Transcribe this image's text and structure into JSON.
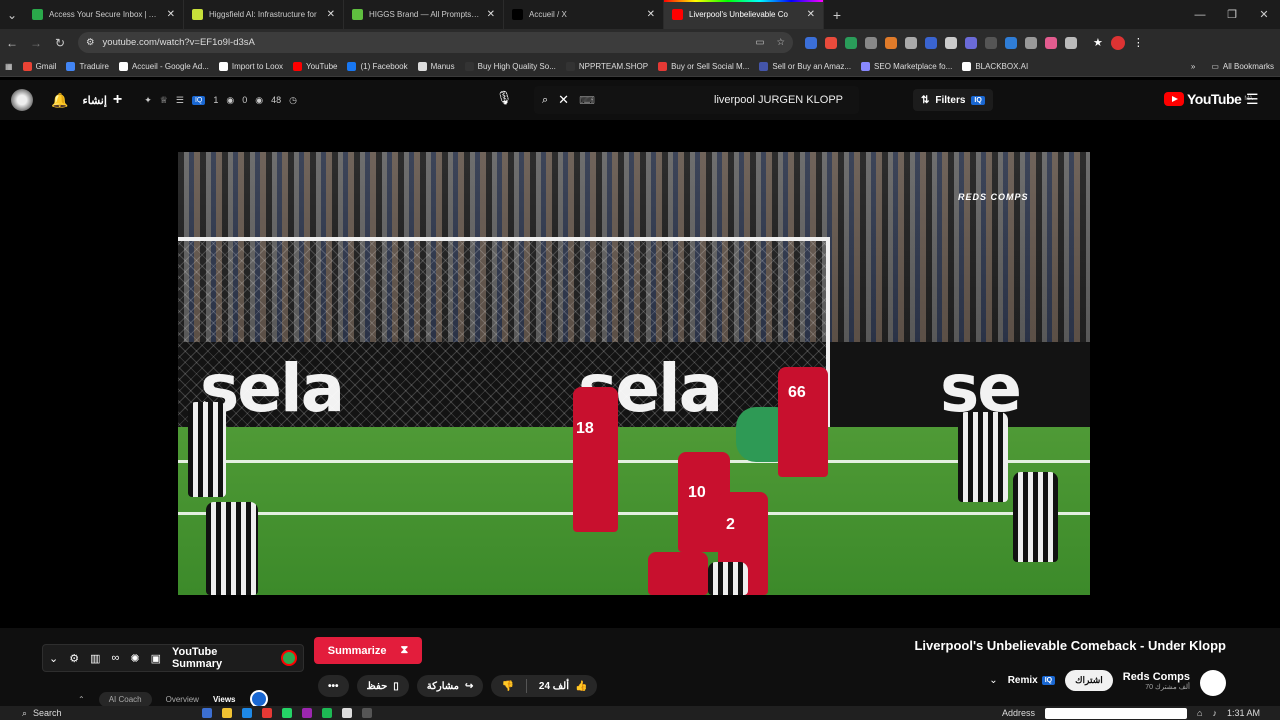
{
  "tabs": [
    {
      "title": "Access Your Secure Inbox | Atom",
      "color": "#2aa84a",
      "active": false
    },
    {
      "title": "Higgsfield AI: Infrastructure for",
      "color": "#c7e03a",
      "active": false
    },
    {
      "title": "HIGGS Brand — All Prompts Usa",
      "color": "#5fbf3f",
      "active": false
    },
    {
      "title": "Accueil / X",
      "color": "#000000",
      "active": false
    },
    {
      "title": "Liverpool's Unbelievable Co",
      "color": "#ff0000",
      "active": true
    }
  ],
  "address": {
    "url": "youtube.com/watch?v=EF1o9l-d3sA"
  },
  "bookmarks": [
    {
      "label": "Gmail",
      "color": "#ea4335"
    },
    {
      "label": "Traduire",
      "color": "#4285f4"
    },
    {
      "label": "Accueil - Google Ad...",
      "color": "#ffffff"
    },
    {
      "label": "Import to Loox",
      "color": "#ffffff"
    },
    {
      "label": "YouTube",
      "color": "#ff0000"
    },
    {
      "label": "(1) Facebook",
      "color": "#1877f2"
    },
    {
      "label": "Manus",
      "color": "#dddddd"
    },
    {
      "label": "Buy High Quality So...",
      "color": "#333333"
    },
    {
      "label": "NPPRTEAM.SHOP",
      "color": "#333333"
    },
    {
      "label": "Buy or Sell Social M...",
      "color": "#e53935"
    },
    {
      "label": "Sell or Buy an Amaz...",
      "color": "#4455aa"
    },
    {
      "label": "SEO Marketplace fo...",
      "color": "#8888ff"
    },
    {
      "label": "BLACKBOX.AI",
      "color": "#ffffff"
    }
  ],
  "all_bookmarks": "All Bookmarks",
  "yt_header": {
    "create_label": "إنشاء",
    "stats": [
      "1",
      "0",
      "48"
    ],
    "search_query": "liverpool  JURGEN KLOPP",
    "filters_label": "Filters",
    "badge": "IQ",
    "logo_text": "YouTube",
    "logo_region": "MA"
  },
  "video": {
    "watermark": "REDS COMPS",
    "sponsor": [
      "sela",
      "sela",
      "se"
    ],
    "numbers": [
      "18",
      "66",
      "10",
      "2"
    ]
  },
  "coach": {
    "label": "YouTube Summary"
  },
  "summarize": {
    "label": "Summarize"
  },
  "subtabs": {
    "ai_coach": "AI Coach",
    "overview": "Overview",
    "views": "Views"
  },
  "video_title": "Liverpool's Unbelievable Comeback - Under Klopp",
  "actions": {
    "more": "•••",
    "save": "حفظ",
    "share": "مشاركة",
    "likes": "24 ألف"
  },
  "channel": {
    "remix": "Remix",
    "subscribe": "اشتراك",
    "name": "Reds Comps",
    "subs": "70 ألف مشترك"
  },
  "taskbar": {
    "search": "Search",
    "address_label": "Address",
    "time": "1:31 AM"
  }
}
